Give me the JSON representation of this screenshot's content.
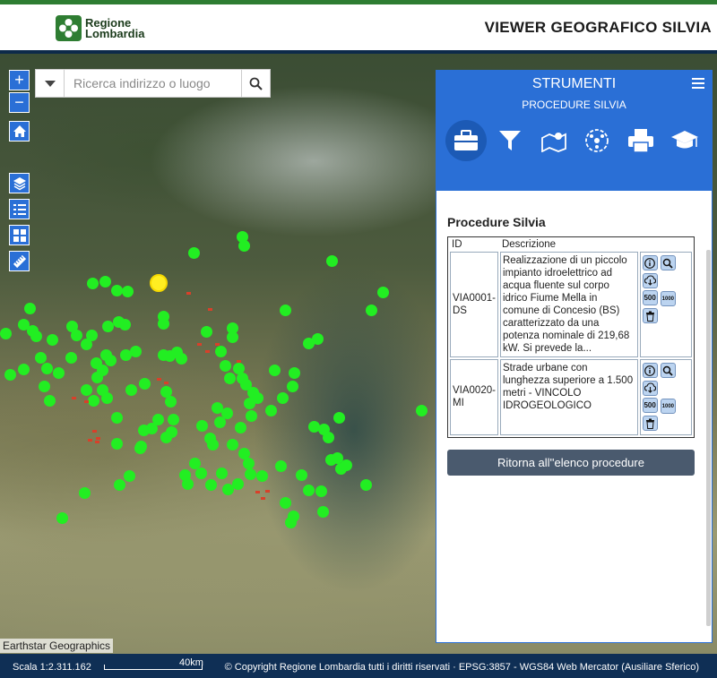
{
  "header": {
    "logo_line1": "Regione",
    "logo_line2": "Lombardia",
    "title": "VIEWER GEOGRAFICO SILVIA"
  },
  "search": {
    "placeholder": "Ricerca indirizzo o luogo"
  },
  "map": {
    "attribution": "Earthstar Geographics",
    "zoom_in": "+",
    "zoom_out": "−"
  },
  "panel": {
    "title": "STRUMENTI",
    "subtitle": "PROCEDURE SILVIA",
    "tools": [
      "toolbox-icon",
      "filter-icon",
      "map-pin-icon",
      "network-icon",
      "print-icon",
      "graduation-cap-icon"
    ],
    "section_title": "Procedure Silvia",
    "table": {
      "headers": [
        "ID",
        "Descrizione"
      ],
      "rows": [
        {
          "id": "VIA0001-DS",
          "desc": "Realizzazione di un piccolo impianto idroelettrico ad acqua fluente sul corpo idrico Fiume Mella in comune di Concesio (BS) caratterizzato da una potenza nominale di 219,68 kW. Si prevede la..."
        },
        {
          "id": "VIA0020-MI",
          "desc": "Strade urbane con lunghezza superiore a 1.500 metri - VINCOLO IDROGEOLOGICO"
        }
      ],
      "action_labels": {
        "scale500": "500",
        "scale1000": "1000"
      }
    },
    "back_label": "Ritorna all''elenco procedure"
  },
  "footer": {
    "scale": "Scala 1:2.311.162",
    "scale_km": "40km",
    "projection": "EPSG:3857 - WGS84 Web Mercator (Ausiliare Sferico)",
    "copyright": "© Copyright Regione Lombardia tutti i diritti riservati"
  },
  "colors": {
    "accent": "#2a6fd6",
    "point": "#22ee22",
    "point_selected": "#ffee22",
    "header_stripe": "#2e7d32",
    "footer": "#0f2f55"
  }
}
